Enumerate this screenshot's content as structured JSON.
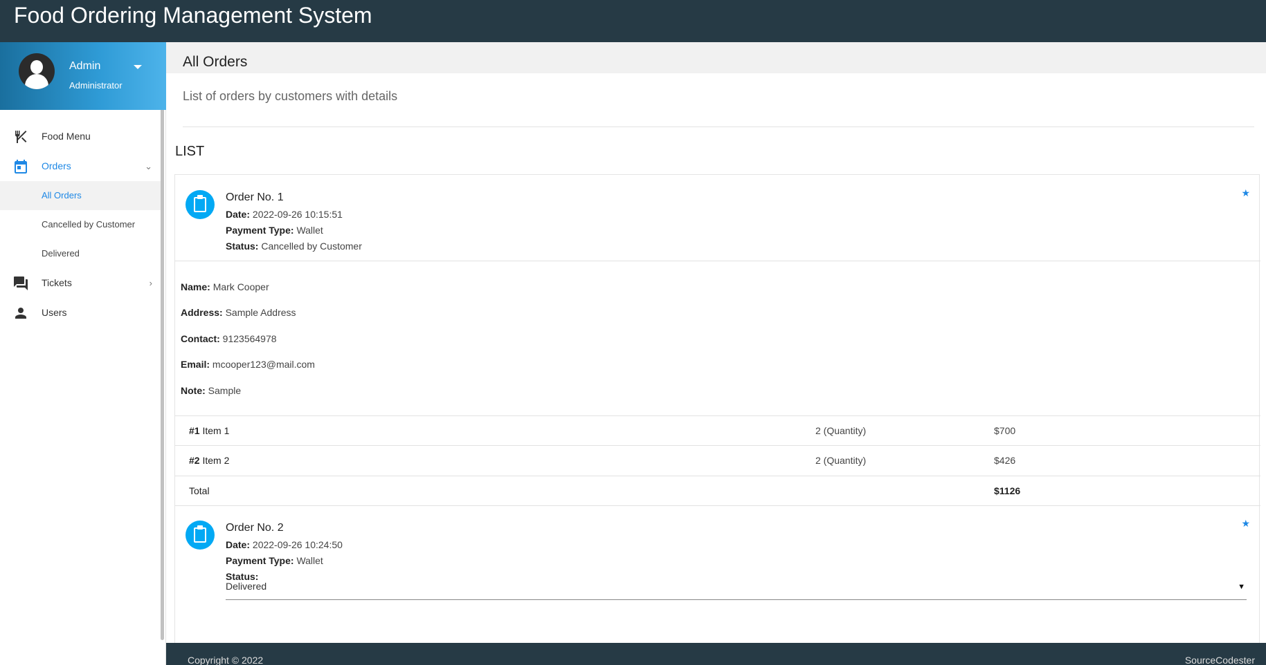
{
  "app": {
    "title": "Food Ordering Management System"
  },
  "user": {
    "name": "Admin",
    "role": "Administrator"
  },
  "sidebar": {
    "items": [
      {
        "label": "Food Menu",
        "icon": "fork-knife-icon"
      },
      {
        "label": "Orders",
        "icon": "calendar-icon",
        "expanded": true,
        "children": [
          {
            "label": "All Orders",
            "active": true
          },
          {
            "label": "Cancelled by Customer"
          },
          {
            "label": "Delivered"
          }
        ]
      },
      {
        "label": "Tickets",
        "icon": "chat-icon"
      },
      {
        "label": "Users",
        "icon": "person-icon"
      }
    ]
  },
  "page": {
    "title": "All Orders",
    "subtitle": "List of orders by customers with details",
    "list_heading": "LIST"
  },
  "labels": {
    "date": "Date:",
    "payment_type": "Payment Type:",
    "status": "Status:",
    "name": "Name:",
    "address": "Address:",
    "contact": "Contact:",
    "email": "Email:",
    "note": "Note:",
    "total": "Total"
  },
  "orders": [
    {
      "title": "Order No. 1",
      "date": "2022-09-26 10:15:51",
      "payment_type": "Wallet",
      "status": "Cancelled by Customer",
      "customer": {
        "name": "Mark Cooper",
        "address": "Sample Address",
        "contact": "9123564978",
        "email": "mcooper123@mail.com",
        "note": "Sample"
      },
      "items": [
        {
          "num": "#1",
          "name": "Item 1",
          "qty": "2 (Quantity)",
          "price": "$700"
        },
        {
          "num": "#2",
          "name": "Item 2",
          "qty": "2 (Quantity)",
          "price": "$426"
        }
      ],
      "total": "$1126"
    },
    {
      "title": "Order No. 2",
      "date": "2022-09-26 10:24:50",
      "payment_type": "Wallet",
      "status": "",
      "status_select": "Delivered"
    }
  ],
  "footer": {
    "copyright": "Copyright © 2022",
    "credit": "SourceCodester"
  },
  "colors": {
    "topbar": "#263a45",
    "accent": "#1e88e5",
    "order_icon": "#03a9f4"
  }
}
